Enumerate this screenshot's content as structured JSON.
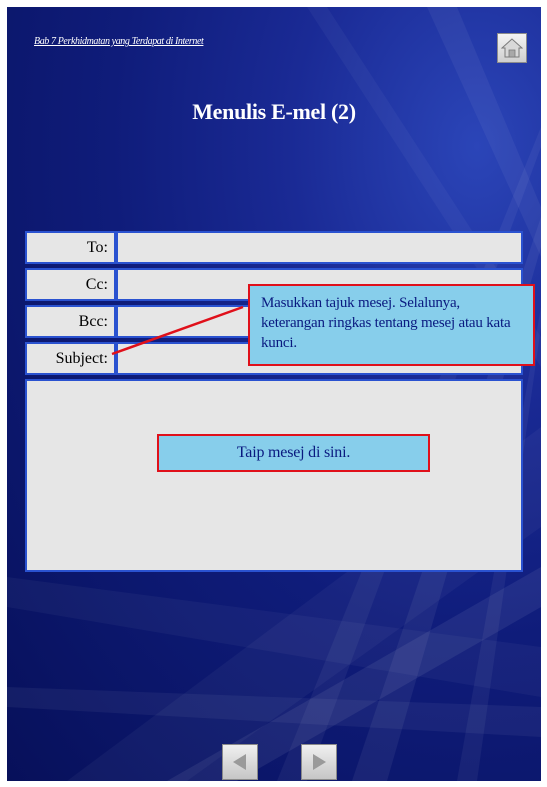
{
  "header": {
    "chapter_link": "Bab 7 Perkhidmatan yang Terdapat di Internet"
  },
  "title": "Menulis E-mel (2)",
  "email_form": {
    "to_label": "To:",
    "cc_label": "Cc:",
    "bcc_label": "Bcc:",
    "subject_label": "Subject:",
    "to_value": "",
    "cc_value": "",
    "bcc_value": "",
    "subject_value": "",
    "body_value": ""
  },
  "callouts": {
    "subject_hint": "Masukkan tajuk mesej. Selalunya, keterangan ringkas tentang mesej atau kata kunci.",
    "body_hint": "Taip mesej di sini."
  },
  "icons": {
    "home": "home-icon",
    "previous": "previous-arrow-icon",
    "next": "next-arrow-icon"
  },
  "colors": {
    "background": "#0f1c7a",
    "field_border": "#2a52d0",
    "field_fill": "#e6e6e6",
    "callout_fill": "#87ceeb",
    "callout_border": "#e0101a",
    "callout_text": "#0a1a80"
  }
}
